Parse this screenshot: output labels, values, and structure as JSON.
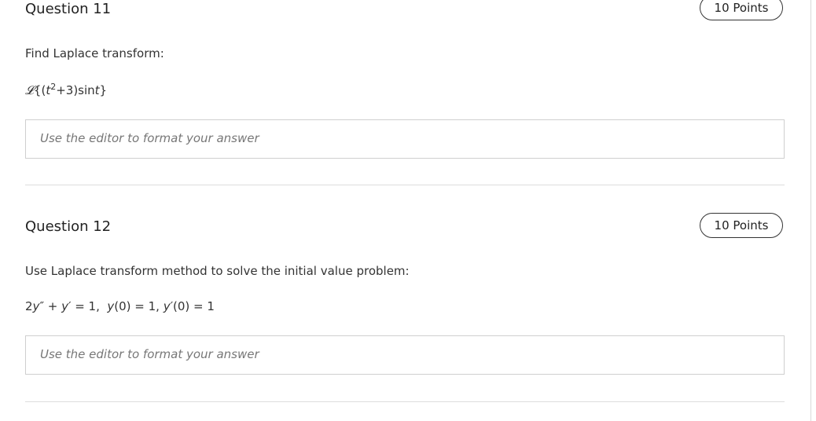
{
  "questions": [
    {
      "title": "Question 11",
      "points": "10 Points",
      "prompt": "Find Laplace transform:",
      "math": {
        "operator": "𝓛",
        "open": "{(",
        "var": "t",
        "exp": "2",
        "rest": "+3)sin",
        "var2": "t",
        "close": "}"
      },
      "answer_placeholder": "Use the editor to format your answer"
    },
    {
      "title": "Question 12",
      "points": "10 Points",
      "prompt": "Use Laplace transform method to solve the initial value problem:",
      "math": {
        "lead": "2",
        "y1": "y″",
        "plus": " + ",
        "y2": "y′",
        "eq1": " = 1,  ",
        "y3": "y",
        "ic1": "(0) = 1, ",
        "y4": "y′",
        "ic2": "(0) = 1"
      },
      "answer_placeholder": "Use the editor to format your answer"
    }
  ]
}
